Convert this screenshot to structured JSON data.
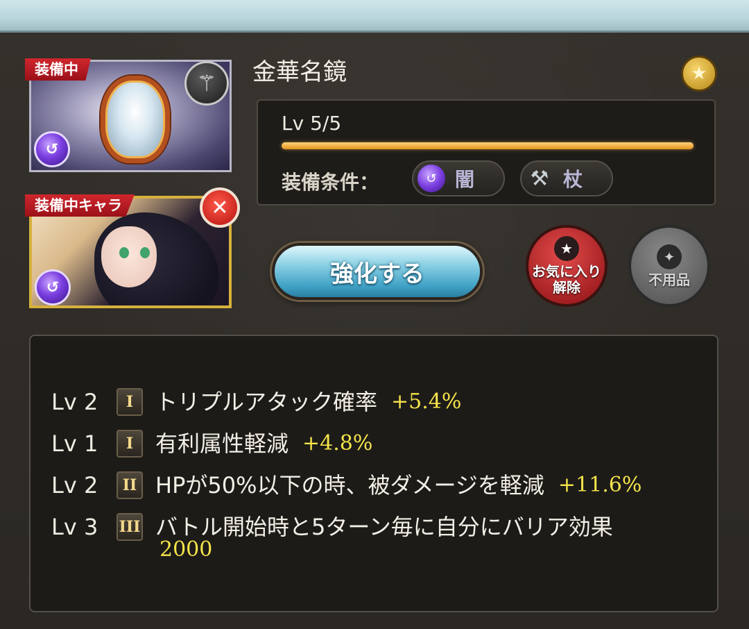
{
  "weapon": {
    "name": "金華名鏡",
    "equipped_label": "装備中",
    "equipped_char_label": "装備中キャラ",
    "level_text": "Lv 5/5",
    "level_progress": 1.0,
    "requirements_label": "装備条件：",
    "requirements": [
      {
        "icon": "dark-element-icon",
        "label": "闇"
      },
      {
        "icon": "staff-icon",
        "label": "杖"
      }
    ]
  },
  "buttons": {
    "enhance": "強化する",
    "unfavorite": "お気に入り\n解除",
    "unneeded": "不用品"
  },
  "skills": [
    {
      "lv": "Lv 2",
      "rank": "I",
      "text": "トリプルアタック確率",
      "value": "+5.4%"
    },
    {
      "lv": "Lv 1",
      "rank": "I",
      "text": "有利属性軽減",
      "value": "+4.8%"
    },
    {
      "lv": "Lv 2",
      "rank": "II",
      "text": "HPが50%以下の時、被ダメージを軽減",
      "value": "+11.6%"
    },
    {
      "lv": "Lv 3",
      "rank": "III",
      "text": "バトル開始時と5ターン毎に自分にバリア効果",
      "value": "2000"
    }
  ],
  "colors": {
    "accent_red": "#c81e25",
    "value_yellow": "#f4e44a",
    "dark_element": "#7b3fe0",
    "enhance_blue": "#3ea0c4"
  }
}
